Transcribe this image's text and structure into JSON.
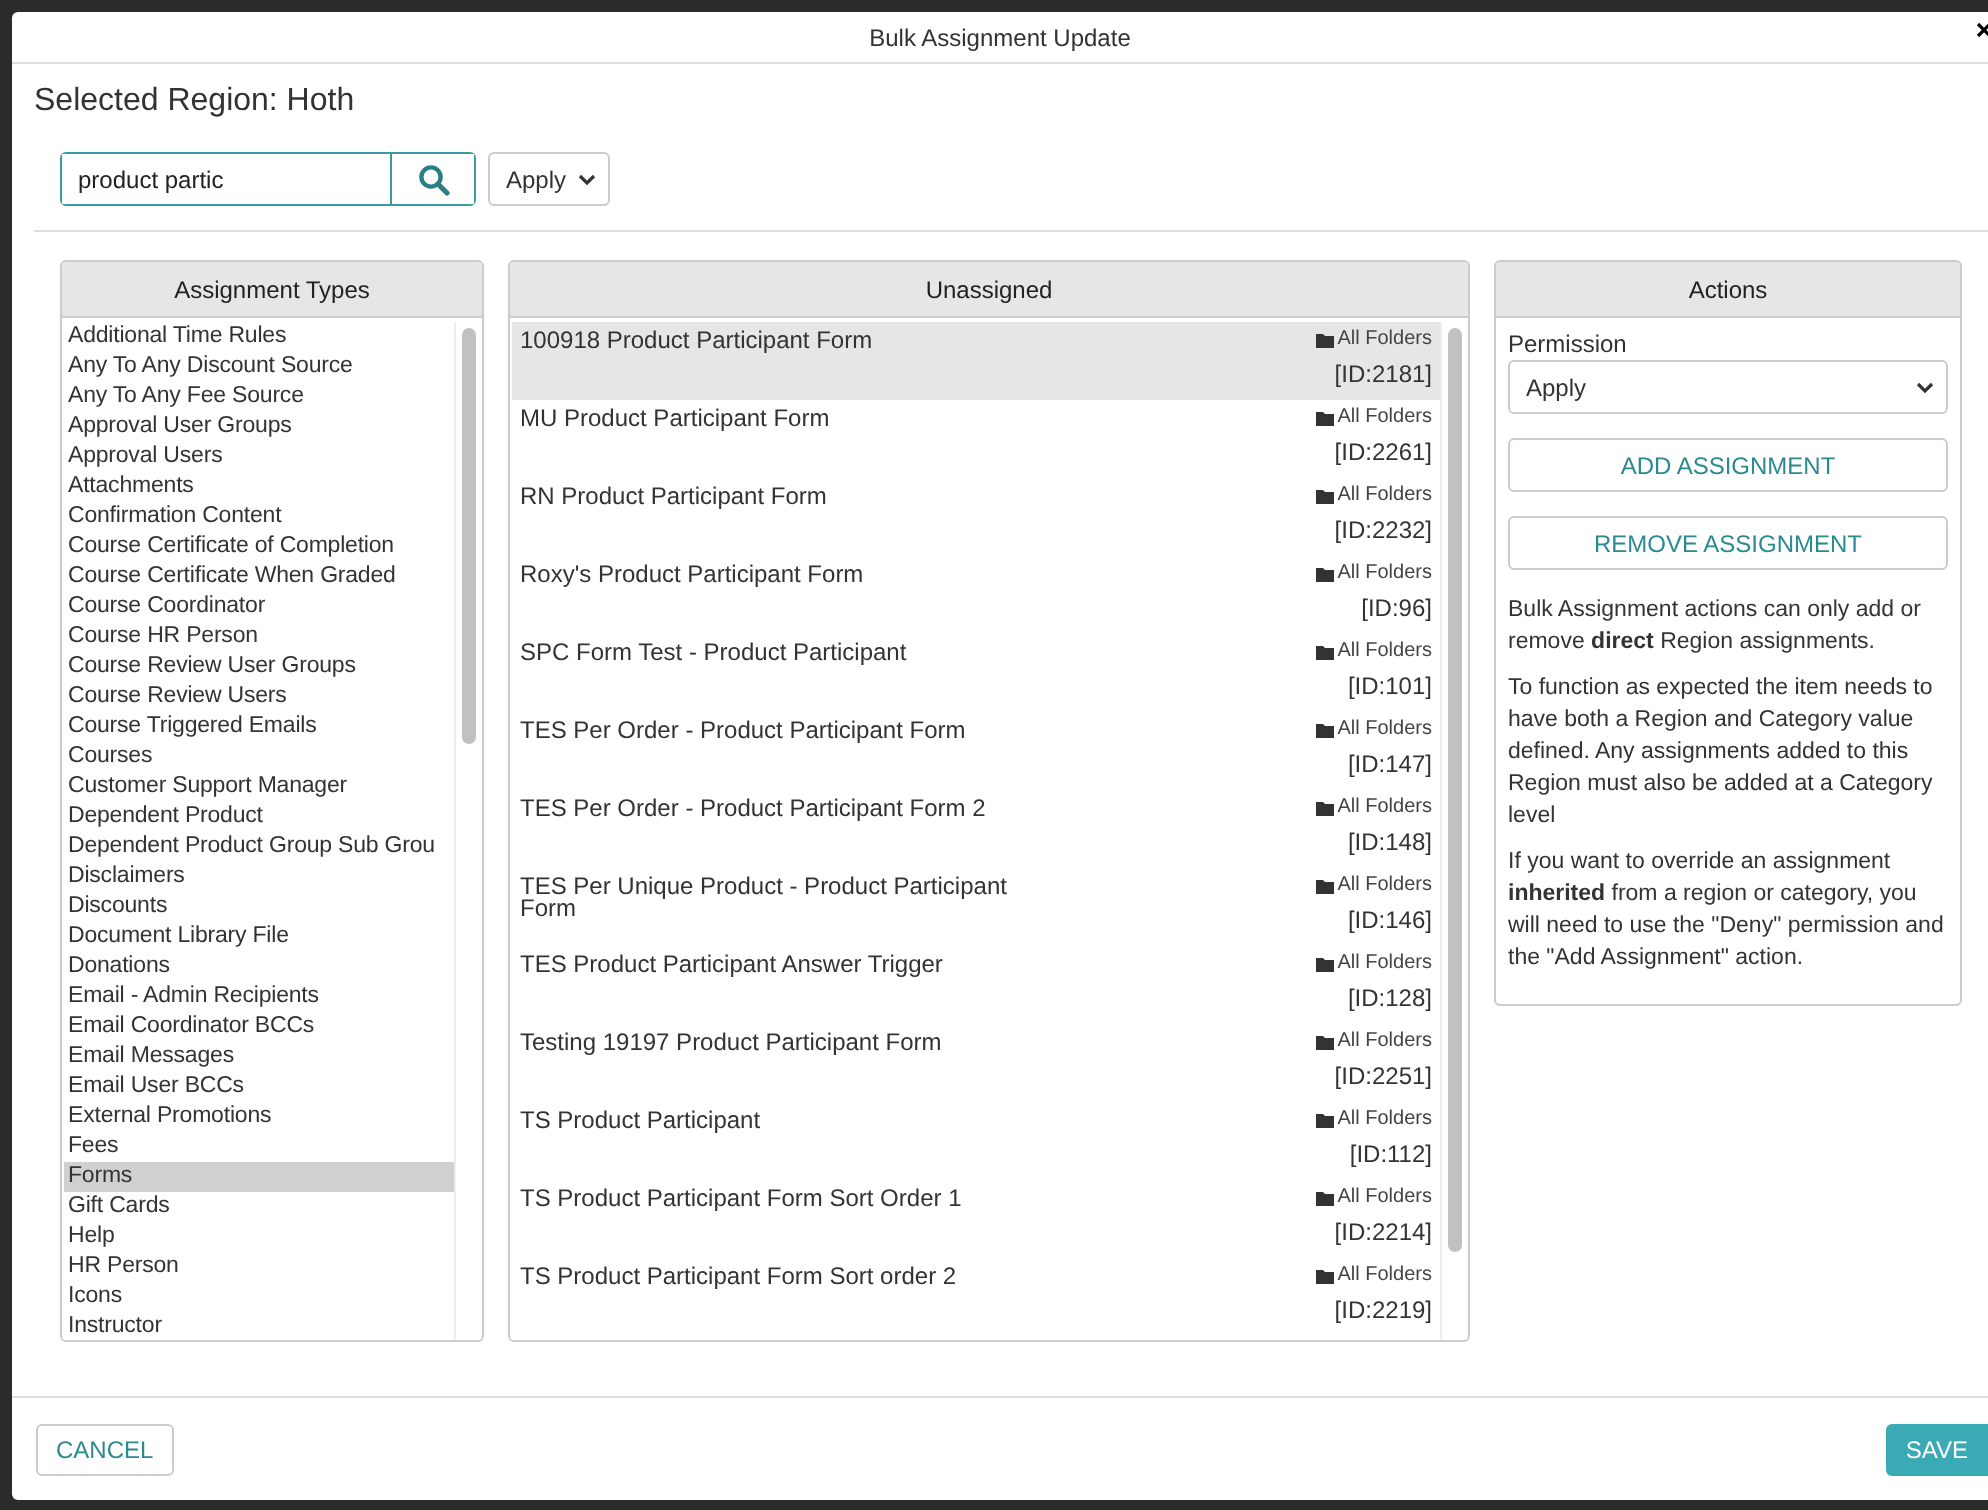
{
  "dialog": {
    "title": "Bulk Assignment Update",
    "heading": "Selected Region: Hoth"
  },
  "search": {
    "value": "product partic"
  },
  "filter_select": {
    "value": "Apply"
  },
  "assignment_types": {
    "title": "Assignment Types",
    "items": [
      {
        "label": "Additional Time Rules",
        "selected": false
      },
      {
        "label": "Any To Any Discount Source",
        "selected": false
      },
      {
        "label": "Any To Any Fee Source",
        "selected": false
      },
      {
        "label": "Approval User Groups",
        "selected": false
      },
      {
        "label": "Approval Users",
        "selected": false
      },
      {
        "label": "Attachments",
        "selected": false
      },
      {
        "label": "Confirmation Content",
        "selected": false
      },
      {
        "label": "Course Certificate of Completion",
        "selected": false
      },
      {
        "label": "Course Certificate When Graded",
        "selected": false
      },
      {
        "label": "Course Coordinator",
        "selected": false
      },
      {
        "label": "Course HR Person",
        "selected": false
      },
      {
        "label": "Course Review User Groups",
        "selected": false
      },
      {
        "label": "Course Review Users",
        "selected": false
      },
      {
        "label": "Course Triggered Emails",
        "selected": false
      },
      {
        "label": "Courses",
        "selected": false
      },
      {
        "label": "Customer Support Manager",
        "selected": false
      },
      {
        "label": "Dependent Product",
        "selected": false
      },
      {
        "label": "Dependent Product Group Sub Grou",
        "selected": false
      },
      {
        "label": "Disclaimers",
        "selected": false
      },
      {
        "label": "Discounts",
        "selected": false
      },
      {
        "label": "Document Library File",
        "selected": false
      },
      {
        "label": "Donations",
        "selected": false
      },
      {
        "label": "Email - Admin Recipients",
        "selected": false
      },
      {
        "label": "Email Coordinator BCCs",
        "selected": false
      },
      {
        "label": "Email Messages",
        "selected": false
      },
      {
        "label": "Email User BCCs",
        "selected": false
      },
      {
        "label": "External Promotions",
        "selected": false
      },
      {
        "label": "Fees",
        "selected": false
      },
      {
        "label": "Forms",
        "selected": true
      },
      {
        "label": "Gift Cards",
        "selected": false
      },
      {
        "label": "Help",
        "selected": false
      },
      {
        "label": "HR Person",
        "selected": false
      },
      {
        "label": "Icons",
        "selected": false
      },
      {
        "label": "Instructor",
        "selected": false
      }
    ]
  },
  "unassigned": {
    "title": "Unassigned",
    "items": [
      {
        "name": "100918 Product Participant Form",
        "folder": "All Folders",
        "id": "[ID:2181]",
        "selected": true
      },
      {
        "name": "MU Product Participant Form",
        "folder": "All Folders",
        "id": "[ID:2261]",
        "selected": false
      },
      {
        "name": "RN Product Participant Form",
        "folder": "All Folders",
        "id": "[ID:2232]",
        "selected": false
      },
      {
        "name": "Roxy's Product Participant Form",
        "folder": "All Folders",
        "id": "[ID:96]",
        "selected": false
      },
      {
        "name": "SPC Form Test - Product Participant",
        "folder": "All Folders",
        "id": "[ID:101]",
        "selected": false
      },
      {
        "name": "TES Per Order - Product Participant Form",
        "folder": "All Folders",
        "id": "[ID:147]",
        "selected": false
      },
      {
        "name": "TES Per Order - Product Participant Form 2",
        "folder": "All Folders",
        "id": "[ID:148]",
        "selected": false
      },
      {
        "name": "TES Per Unique Product - Product Participant Form",
        "folder": "All Folders",
        "id": "[ID:146]",
        "selected": false
      },
      {
        "name": "TES Product Participant Answer Trigger",
        "folder": "All Folders",
        "id": "[ID:128]",
        "selected": false
      },
      {
        "name": "Testing 19197 Product Participant Form",
        "folder": "All Folders",
        "id": "[ID:2251]",
        "selected": false
      },
      {
        "name": "TS Product Participant",
        "folder": "All Folders",
        "id": "[ID:112]",
        "selected": false
      },
      {
        "name": "TS Product Participant Form Sort Order 1",
        "folder": "All Folders",
        "id": "[ID:2214]",
        "selected": false
      },
      {
        "name": "TS Product Participant Form Sort order 2",
        "folder": "All Folders",
        "id": "[ID:2219]",
        "selected": false
      }
    ]
  },
  "actions": {
    "title": "Actions",
    "permission_label": "Permission",
    "permission_value": "Apply",
    "buttons": [
      "ADD ASSIGNMENT",
      "REMOVE ASSIGNMENT"
    ],
    "notes": [
      "Bulk Assignment actions can only add or remove **direct** Region assignments.",
      "To function as expected the item needs to have both a Region and Category value defined. Any assignments added to this Region must also be added at a Category level",
      "If you want to override an assignment **inherited** from a region or category, you will need to use the \"Deny\" permission and the \"Add Assignment\" action."
    ]
  },
  "footer": {
    "cancel": "CANCEL",
    "save": "SAVE"
  }
}
